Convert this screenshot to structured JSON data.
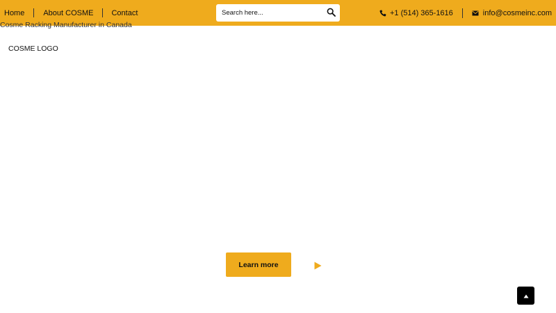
{
  "nav": {
    "home": "Home",
    "about": "About COSME",
    "contact": "Contact"
  },
  "search": {
    "placeholder": "Search here..."
  },
  "contact": {
    "phone": "+1 (514) 365-1616",
    "email": "info@cosmeinc.com"
  },
  "tagline": "Cosme Racking Manufacturer in Canada",
  "logo_text": "COSME LOGO",
  "cta": {
    "learn_more": "Learn more"
  },
  "colors": {
    "accent": "#efab1d",
    "scroll_button": "#000000"
  },
  "icons": {
    "search": "search-icon",
    "phone": "phone-icon",
    "email": "envelope-icon",
    "play": "play-icon",
    "scroll_top": "chevron-up-icon"
  }
}
